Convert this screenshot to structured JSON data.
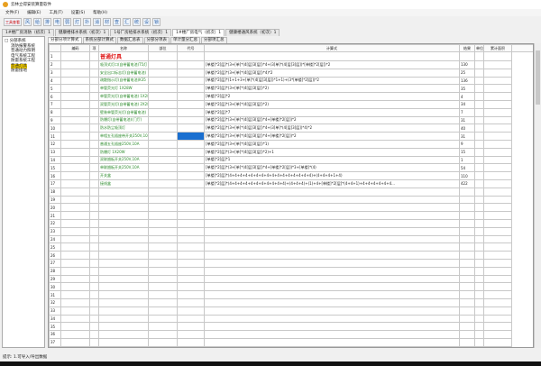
{
  "title": "云林立得安装算量软件",
  "menu": [
    "文件(F)",
    "编辑(E)",
    "工具(T)",
    "设置(S)",
    "帮助(H)"
  ],
  "toolbar": {
    "main_button": "工具查看",
    "icons": [
      "风",
      "给",
      "排",
      "电",
      "弱",
      "灯",
      "扑",
      "消",
      "材",
      "查",
      "汇",
      "统",
      "设",
      "锁"
    ]
  },
  "tabs": [
    {
      "label": "1#楼厂房消防（初次）1",
      "active": false
    },
    {
      "label": "健康楼排水系统（初次）1",
      "active": false
    },
    {
      "label": "1号厂房给排水系统（初次）1",
      "active": false
    },
    {
      "label": "1#楼厂房电气（初次）1",
      "active": true
    },
    {
      "label": "健康楼通风系统（初次）1",
      "active": false
    }
  ],
  "tree": [
    {
      "label": "□ 分部系统",
      "sel": false
    },
    {
      "label": "消防报警系统",
      "sel": false
    },
    {
      "label": "普通动力照明",
      "sel": false
    },
    {
      "label": "电气系统工程",
      "sel": false
    },
    {
      "label": "防雷系统工程",
      "sel": false
    },
    {
      "label": "普通灯具",
      "sel": true
    },
    {
      "label": "防雷接地",
      "sel": false
    }
  ],
  "inner_tabs": [
    {
      "label": "分部分项计算式",
      "active": true
    },
    {
      "label": "系统分部计算式",
      "active": false
    },
    {
      "label": "数据汇总表",
      "active": false
    },
    {
      "label": "分部分项表",
      "active": false
    },
    {
      "label": "单计量分汇总",
      "active": false
    },
    {
      "label": "分部项汇总",
      "active": false
    }
  ],
  "columns": [
    "",
    "编码",
    "项",
    "名称",
    "部位",
    "代号",
    "计算式",
    "结果",
    "单位",
    "累计面积"
  ],
  "rows": [
    {
      "name": "普通灯具",
      "formula": "",
      "result": "",
      "heading": true
    },
    {
      "name": "吸顶式灯口(自带蓄电池)T5灯",
      "formula": "[单楼]*2[层]*(3+[单]*(4[层]3[层])*4+(3[单]*(4[层]3[层])*[单楼]*2[层])*2",
      "result": "130"
    },
    {
      "name": "安全出口标志灯(自带蓄电池)",
      "formula": "[单楼]*2[层]*(3+[单]*(4[层]3[层])*4)*2",
      "result": "25"
    },
    {
      "name": "疏散指示灯(自带蓄电池)K35",
      "formula": "[单楼]*2[层]*(1+1+3+[单]*(4[层]3[层])*1+1)+(3*[单楼]*2[层])*2",
      "result": "136"
    },
    {
      "name": "单管荧光灯 1X28W",
      "formula": "[单楼]*2[层]*(3+[单]*(4[层]3[层])*2)",
      "result": "35"
    },
    {
      "name": "单管荧光灯(自带蓄电池) 1X28W",
      "formula": "[单楼]*2[层]*2",
      "result": "4"
    },
    {
      "name": "双管荧光灯(自带蓄电池) 2X28W",
      "formula": "[单楼]*2[层]*(3+[单]*(4[层]3[层])*2)",
      "result": "34"
    },
    {
      "name": "壁装单管荧光灯(自带蓄电池)",
      "formula": "[单楼]*2[层]*7",
      "result": "7"
    },
    {
      "name": "防爆灯(自带蓄电池)(门厅)",
      "formula": "[单楼]*2[层]*(3+[单]*(4[层]3[层])*4+[单楼]*2[层])*2",
      "result": "31"
    },
    {
      "name": "防水防尘吸顶灯",
      "formula": "[单楼]*2[层]*(3+[单]*(4[层]3[层])*4+(3[单]*(4[层]3[层])*4)*2",
      "result": "40"
    },
    {
      "name": "单相五孔插座带开关250V,10A",
      "formula": "[单楼]*2[层]*(3+[单]*(4[层]3[层])*4+[单楼]*2[层])*2",
      "result": "31",
      "blue": true
    },
    {
      "name": "普通五孔插座250V,10A",
      "formula": "[单楼]*2[层]*(3+[单]*(4[层]3[层])*1)",
      "result": "9"
    },
    {
      "name": "防爆灯 1X20W",
      "formula": "[单楼]*2[层]*(3+[单]*(4[层]3[层])*2)+1",
      "result": "15"
    },
    {
      "name": "双联翘板开关250V,10A",
      "formula": "[单楼]*2[层]*1",
      "result": "1"
    },
    {
      "name": "单联翘板开关250V,10A",
      "formula": "[单楼]*2[层]*(3+[单]*(4[层]3[层])*4+[单楼]*2[层])*3+[单楼]*(4)",
      "result": "54"
    },
    {
      "name": "开关盒",
      "formula": "[单楼]*2[层]*(4+4+4+4+4+4+4+4+4+4+4+4+4+4+4+4)+(4+4+4+1+4)",
      "result": "110"
    },
    {
      "name": "接线盒",
      "formula": "[单楼]*2[层]*(4+4+4+4+4+4+4+4+4+4+4)+(4+4+4)+(1)+4+[单楼]*2[层]*(4+4+1)+4+4+4+4+4+4...",
      "result": "422"
    }
  ],
  "total_rows": 37,
  "status": "提示: 1.可导入/导出数据"
}
